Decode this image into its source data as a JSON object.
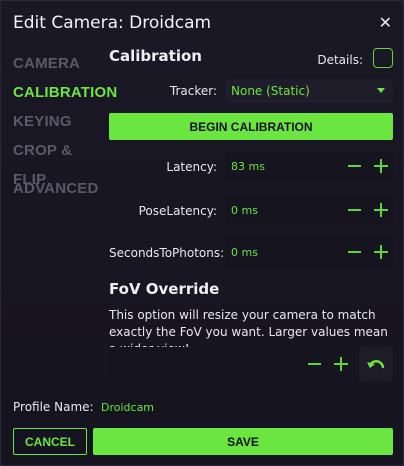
{
  "window": {
    "title": "Edit Camera: Droidcam",
    "close_icon": "close-icon"
  },
  "nav": {
    "items": [
      {
        "label": "CAMERA",
        "active": false
      },
      {
        "label": "CALIBRATION",
        "active": true
      },
      {
        "label": "KEYING",
        "active": false
      },
      {
        "label": "CROP & FLIP",
        "active": false
      },
      {
        "label": "ADVANCED",
        "active": false
      }
    ]
  },
  "calibration": {
    "section_title": "Calibration",
    "details_label": "Details:",
    "details_checked": false,
    "tracker_label": "Tracker:",
    "tracker_value": "None (Static)",
    "begin_button": "BEGIN CALIBRATION",
    "latency": {
      "label": "Latency:",
      "value": "83 ms"
    },
    "pose_latency": {
      "label": "PoseLatency:",
      "value": "0 ms"
    },
    "seconds_to_photons": {
      "label": "SecondsToPhotons:",
      "value": "0 ms"
    }
  },
  "fov": {
    "section_title": "FoV Override",
    "description": "This option will resize your camera to match exactly the FoV you want. Larger values mean a wider view!",
    "value": ""
  },
  "profile": {
    "label": "Profile Name:",
    "value": "Droidcam"
  },
  "actions": {
    "cancel": "CANCEL",
    "save": "SAVE"
  },
  "colors": {
    "accent": "#6be540",
    "background": "#1b1826",
    "field": "#16141e",
    "inactive_nav": "#5b5969"
  }
}
